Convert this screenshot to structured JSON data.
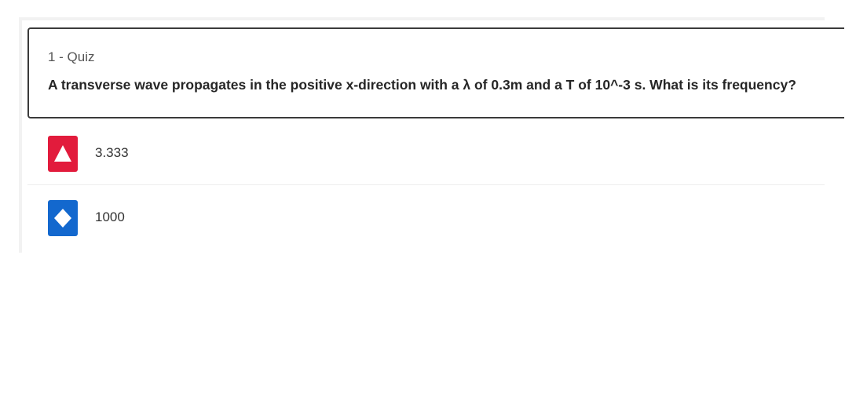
{
  "quiz": {
    "label": "1 - Quiz",
    "question": "A transverse wave propagates in the positive x-direction with a λ of 0.3m and a T of 10^-3 s. What is its frequency?"
  },
  "answers": [
    {
      "text": "3.333",
      "shape": "triangle-icon",
      "color": "#e21b3c"
    },
    {
      "text": "1000",
      "shape": "diamond-icon",
      "color": "#1368ce"
    }
  ]
}
